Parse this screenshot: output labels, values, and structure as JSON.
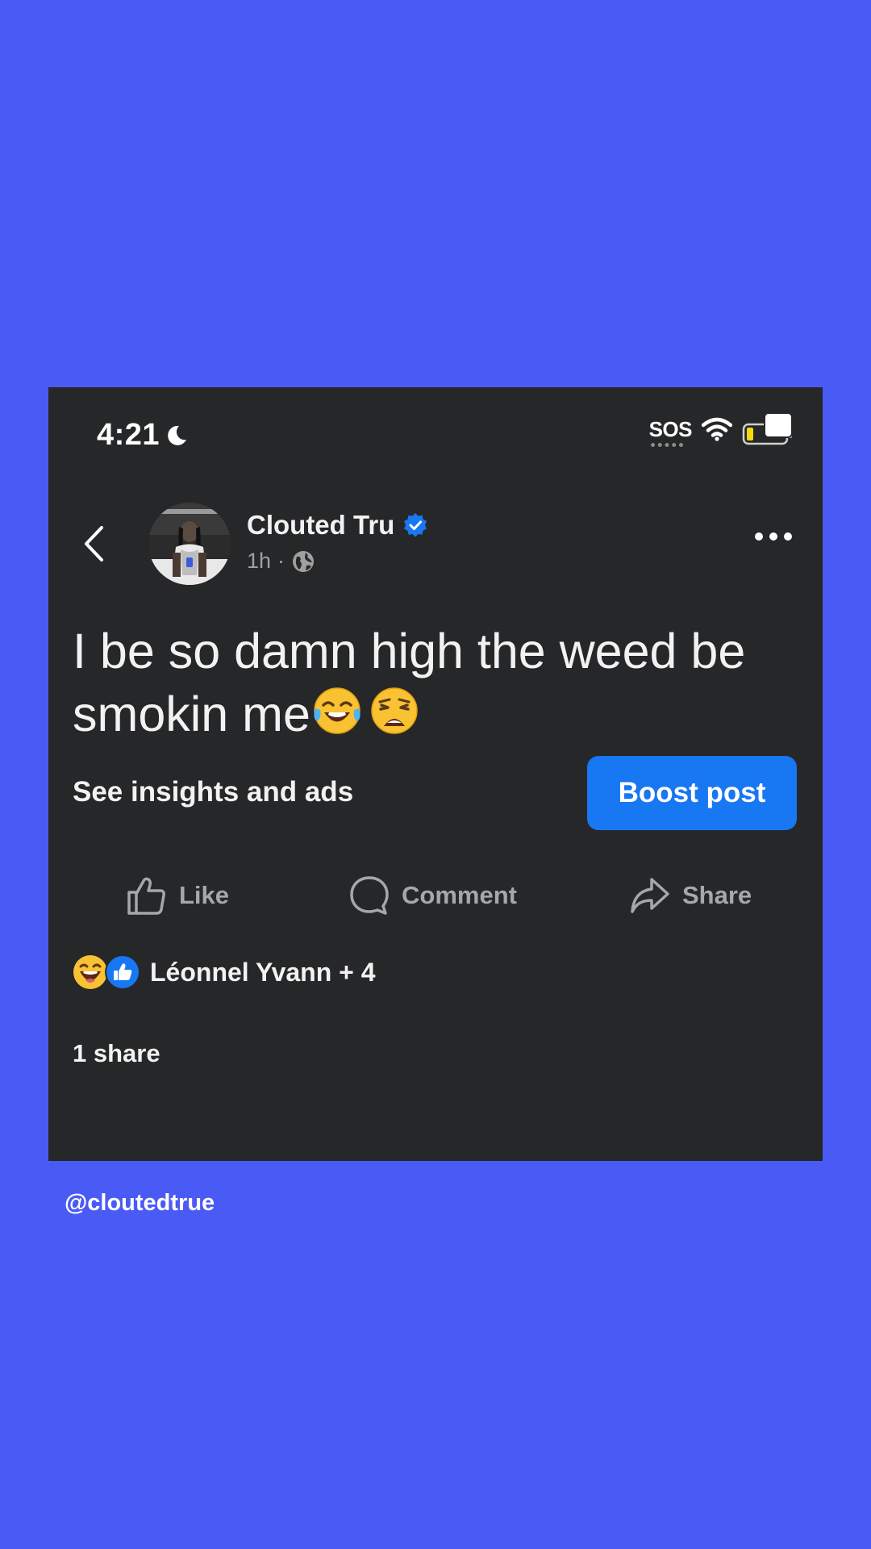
{
  "status_bar": {
    "time": "4:21",
    "carrier": "SOS",
    "icons": [
      "moon-icon",
      "wifi-icon",
      "battery-icon"
    ]
  },
  "post": {
    "author": "Clouted Tru",
    "time_ago": "1h",
    "separator": "·",
    "text": "I be so damn high the weed be smokin me",
    "text_emojis": [
      "face-with-tears-of-joy",
      "weary-face"
    ],
    "insights_label": "See insights and ads",
    "boost_label": "Boost post"
  },
  "actions": {
    "like": "Like",
    "comment": "Comment",
    "share": "Share"
  },
  "reactions": {
    "icons": [
      "laughing-emoji",
      "like-reaction"
    ],
    "names": "Léonnel Yvann + 4"
  },
  "shares_count": "1 share",
  "watermark": "@cloutedtrue",
  "colors": {
    "background": "#4a5bf5",
    "card": "#262728",
    "accent": "#1877f2",
    "muted": "#a6a7ab"
  }
}
